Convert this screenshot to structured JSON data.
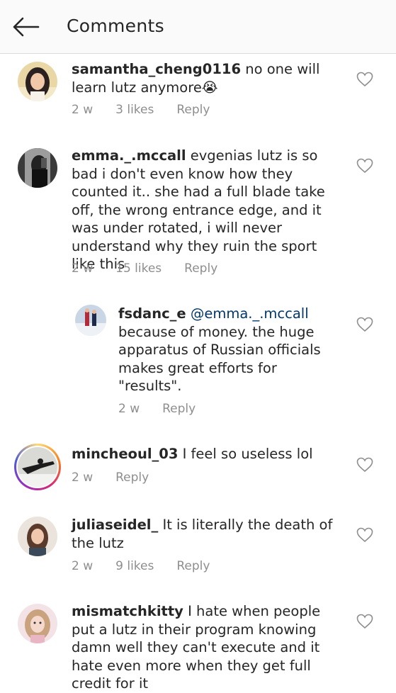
{
  "header": {
    "title": "Comments"
  },
  "comments": [
    {
      "username": "samantha_cheng0116",
      "text": "no one will learn lutz anymore😭",
      "time": "2 w",
      "likes": "3 likes",
      "reply": "Reply"
    },
    {
      "username": "emma._.mccall",
      "text": "evgenias lutz is so bad i don't even know how they counted it.. she had a full blade take off, the wrong entrance edge, and it was under rotated, i will never understand why they ruin the sport like this",
      "time": "2 w",
      "likes": "15 likes",
      "reply": "Reply"
    },
    {
      "username": "fsdanc_e",
      "mention": "@emma._.mccall",
      "text": "because of money. the huge apparatus of Russian officials makes great efforts for \"results\".",
      "time": "2 w",
      "reply": "Reply"
    },
    {
      "username": "mincheoul_03",
      "text": "I feel so useless lol",
      "time": "2 w",
      "reply": "Reply"
    },
    {
      "username": "juliaseidel_",
      "text": "It is literally the death of the lutz",
      "time": "2 w",
      "likes": "9 likes",
      "reply": "Reply"
    },
    {
      "username": "mismatchkitty",
      "text": "I hate when people put a lutz in their program knowing damn well they can't execute and it hate even more when they get full credit for it"
    }
  ],
  "icons": {
    "back": "arrow-left-icon",
    "like": "heart-outline-icon"
  },
  "colors": {
    "text": "#262626",
    "meta": "#8e8e8e",
    "mention": "#00376b",
    "header_bg": "#fafafa"
  }
}
